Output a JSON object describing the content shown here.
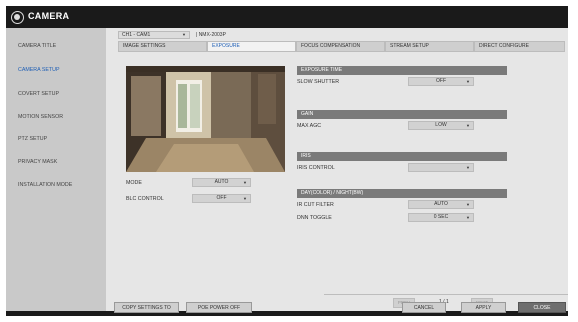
{
  "app": {
    "title": "CAMERA"
  },
  "sidebar": {
    "items": [
      {
        "label": "CAMERA TITLE",
        "active": false
      },
      {
        "label": "CAMERA SETUP",
        "active": true
      },
      {
        "label": "COVERT SETUP",
        "active": false
      },
      {
        "label": "MOTION SENSOR",
        "active": false
      },
      {
        "label": "PTZ SETUP",
        "active": false
      },
      {
        "label": "PRIVACY MASK",
        "active": false
      },
      {
        "label": "INSTALLATION MODE",
        "active": false
      }
    ]
  },
  "channel": {
    "selected": "CH1 - CAM1",
    "model": "| NMX-2003P"
  },
  "tabs": [
    {
      "label": "IMAGE SETTINGS",
      "active": false
    },
    {
      "label": "EXPOSURE",
      "active": true
    },
    {
      "label": "FOCUS COMPENSATION",
      "active": false
    },
    {
      "label": "STREAM SETUP",
      "active": false
    },
    {
      "label": "DIRECT CONFIGURE",
      "active": false
    }
  ],
  "left_controls": {
    "mode": {
      "label": "MODE",
      "value": "AUTO"
    },
    "blc": {
      "label": "BLC CONTROL",
      "value": "OFF"
    }
  },
  "sections": {
    "exposure_time": {
      "header": "EXPOSURE TIME",
      "label": "SLOW SHUTTER",
      "value": "OFF"
    },
    "gain": {
      "header": "GAIN",
      "label": "MAX AGC",
      "value": "LOW"
    },
    "iris": {
      "header": "IRIS",
      "label": "IRIS CONTROL",
      "value": ""
    },
    "day_night": {
      "header": "DAY(COLOR) / NIGHT(BW)",
      "ir_cut_label": "IR CUT FILTER",
      "ir_cut_value": "AUTO",
      "dnn_label": "DNN TOGGLE",
      "dnn_value": "0 SEC"
    }
  },
  "pager": {
    "prev": "PREV",
    "text": "1 / 1",
    "next": "NEXT"
  },
  "footer": {
    "copy": "COPY SETTINGS TO",
    "poe": "POE POWER OFF",
    "cancel": "CANCEL",
    "apply": "APPLY",
    "close": "CLOSE"
  },
  "icons": {
    "logo": "camera-logo-icon",
    "dropdown": "chevron-down-icon"
  },
  "colors": {
    "accent": "#1f5fb5",
    "titlebar": "#1a1a1a",
    "section": "#7a7a7a"
  }
}
